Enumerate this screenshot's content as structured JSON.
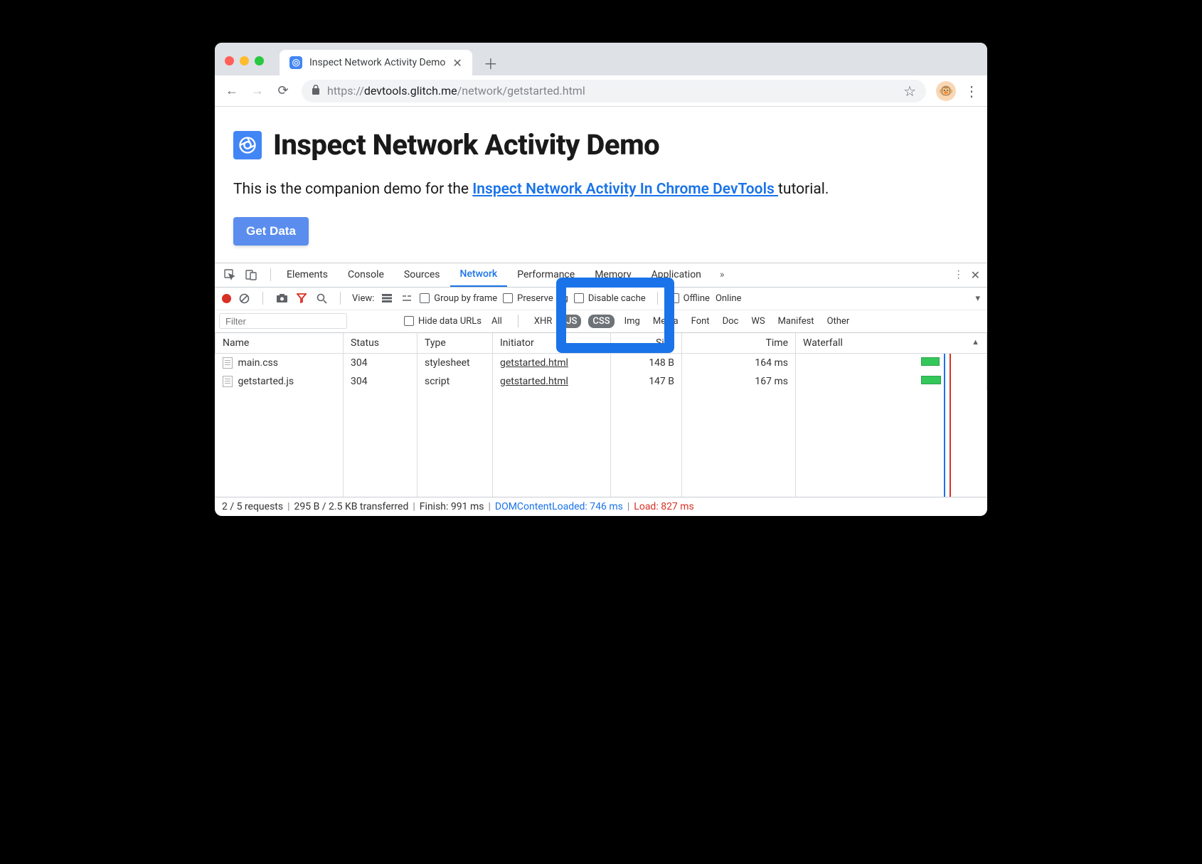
{
  "browser": {
    "tab_title": "Inspect Network Activity Demo",
    "url_prefix": "https://",
    "url_host": "devtools.glitch.me",
    "url_path": "/network/getstarted.html"
  },
  "page": {
    "title": "Inspect Network Activity Demo",
    "intro_prefix": "This is the companion demo for the ",
    "intro_link": "Inspect Network Activity In Chrome DevTools ",
    "intro_suffix": "tutorial.",
    "button_label": "Get Data"
  },
  "devtools": {
    "tabs": [
      "Elements",
      "Console",
      "Sources",
      "Network",
      "Performance",
      "Memory",
      "Application"
    ],
    "active_tab": "Network",
    "net_toolbar": {
      "view_label": "View:",
      "group_by_frame": "Group by frame",
      "preserve_log": "Preserve log",
      "disable_cache": "Disable cache",
      "offline": "Offline",
      "online": "Online"
    },
    "filter_bar": {
      "placeholder": "Filter",
      "hide_data_urls": "Hide data URLs",
      "types": [
        "All",
        "XHR",
        "JS",
        "CSS",
        "Img",
        "Media",
        "Font",
        "Doc",
        "WS",
        "Manifest",
        "Other"
      ],
      "active_types": [
        "JS",
        "CSS"
      ]
    },
    "columns": [
      "Name",
      "Status",
      "Type",
      "Initiator",
      "Size",
      "Time",
      "Waterfall"
    ],
    "rows": [
      {
        "name": "main.css",
        "status": "304",
        "type": "stylesheet",
        "initiator": "getstarted.html",
        "size": "148 B",
        "time": "164 ms"
      },
      {
        "name": "getstarted.js",
        "status": "304",
        "type": "script",
        "initiator": "getstarted.html",
        "size": "147 B",
        "time": "167 ms"
      }
    ],
    "status": {
      "requests": "2 / 5 requests",
      "transferred": "295 B / 2.5 KB transferred",
      "finish": "Finish: 991 ms",
      "dcl": "DOMContentLoaded: 746 ms",
      "load": "Load: 827 ms"
    }
  }
}
